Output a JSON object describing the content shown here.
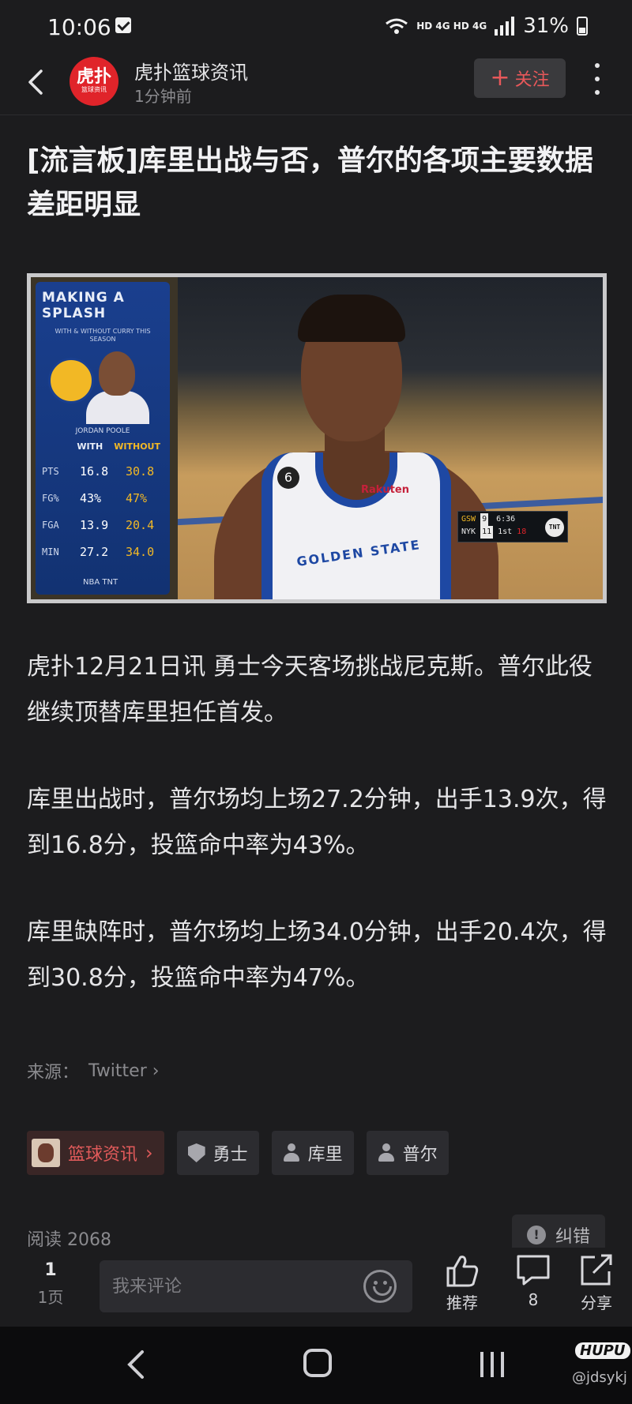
{
  "status_bar": {
    "time": "10:06",
    "network": "HD 4G HD 4G",
    "battery": "31%"
  },
  "header": {
    "logo_text": "虎扑",
    "logo_sub": "篮球资讯",
    "channel_name": "虎扑篮球资讯",
    "post_time": "1分钟前",
    "follow_label": "关注"
  },
  "article": {
    "title": "[流言板]库里出战与否，普尔的各项主要数据差距明显",
    "image": {
      "panel_title": "MAKING A SPLASH",
      "panel_subtitle": "WITH & WITHOUT CURRY THIS SEASON",
      "player_name": "JORDAN POOLE",
      "col_with": "WITH",
      "col_without": "WITHOUT",
      "stats": [
        {
          "label": "PTS",
          "with": "16.8",
          "without": "30.8"
        },
        {
          "label": "FG%",
          "with": "43%",
          "without": "47%"
        },
        {
          "label": "FGA",
          "with": "13.9",
          "without": "20.4"
        },
        {
          "label": "MIN",
          "with": "27.2",
          "without": "34.0"
        }
      ],
      "panel_logos": "NBA TNT",
      "jersey_text": "GOLDEN STATE",
      "jersey_sponsor": "Rakuten",
      "jersey_number": "6",
      "scorebug": {
        "team1": "GSW",
        "score1": "9",
        "team2": "NYK",
        "score2": "11",
        "clock": "6:36",
        "quarter": "1st",
        "shot_clock": "18",
        "network": "TNT"
      }
    },
    "paragraphs": [
      "虎扑12月21日讯 勇士今天客场挑战尼克斯。普尔此役继续顶替库里担任首发。",
      "库里出战时，普尔场均上场27.2分钟，出手13.9次，得到16.8分，投篮命中率为43%。",
      "库里缺阵时，普尔场均上场34.0分钟，出手20.4次，得到30.8分，投篮命中率为47%。"
    ],
    "source_label": "来源：",
    "source_value": "Twitter"
  },
  "tags": [
    {
      "label": "篮球资讯",
      "kind": "channel"
    },
    {
      "label": "勇士",
      "kind": "team"
    },
    {
      "label": "库里",
      "kind": "person"
    },
    {
      "label": "普尔",
      "kind": "person"
    }
  ],
  "stats_row": {
    "reads": "阅读 2068",
    "report_label": "纠错"
  },
  "action_bar": {
    "page_current": "1",
    "page_total": "1页",
    "comment_placeholder": "我来评论",
    "like_label": "推荐",
    "comment_count": "8",
    "share_label": "分享"
  },
  "watermark": {
    "brand": "HUPU",
    "user": "@jdsykj"
  },
  "colors": {
    "background": "#1c1c1e",
    "accent_red": "#e05a5a",
    "follow_red": "#e8585a",
    "warriors_blue": "#1e48a3",
    "warriors_gold": "#f2b825"
  }
}
